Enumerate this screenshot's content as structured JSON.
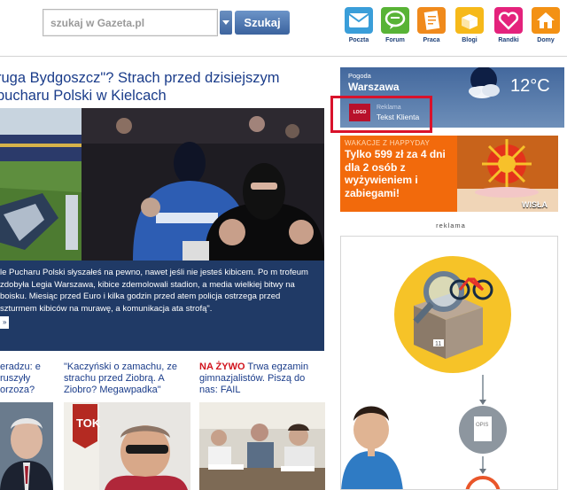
{
  "search": {
    "placeholder": "szukaj w Gazeta.pl",
    "button_label": "Szukaj"
  },
  "services": [
    {
      "label": "Poczta",
      "icon": "mail-icon",
      "color": "#3a9ed9"
    },
    {
      "label": "Forum",
      "icon": "speech-bubble-icon",
      "color": "#58b336"
    },
    {
      "label": "Praca",
      "icon": "document-icon",
      "color": "#f08a1c"
    },
    {
      "label": "Blogi",
      "icon": "box-icon",
      "color": "#f6b91a"
    },
    {
      "label": "Randki",
      "icon": "heart-icon",
      "color": "#e4227c"
    },
    {
      "label": "Domy",
      "icon": "house-icon",
      "color": "#f39114"
    }
  ],
  "main": {
    "headline": "ruga Bydgoszcz\"? Strach przed dzisiejszym pucharu Polski w Kielcach",
    "caption": "le Pucharu Polski słyszałeś na pewno, nawet jeśli nie jesteś kibicem. Po m trofeum zdobyła Legia Warszawa, kibice zdemolowali stadion, a media wielkiej bitwy na boisku. Miesiąc przed Euro i kilka godzin przed atem policja ostrzega przed szturmem kibiców na murawę, a komunikacja ata strofą\".",
    "caption_more": "»",
    "stories": [
      {
        "text": "eradzu: e ruszyły orzoza?"
      },
      {
        "text": "\"Kaczyński o zamachu, ze strachu przed Ziobrą. A Ziobro? Megawpadka\""
      },
      {
        "live": "NA ŻYWO",
        "text": " Trwa egzamin gimnazjalistów. Piszą do nas: FAIL"
      }
    ]
  },
  "weather": {
    "label": "Pogoda",
    "city": "Warszawa",
    "temp": "12°C",
    "ad_logo": "LOGO",
    "ad_kind": "Reklama",
    "ad_client": "Tekst Klienta"
  },
  "promo": {
    "kicker": "WAKACJE Z HAPPYDAY",
    "text": "Tylko 599 zł za 4 dni dla 2 osób z wyżywieniem i zabiegami!",
    "tag": "WISŁA"
  },
  "ad": {
    "label": "reklama",
    "box_text": "11",
    "doc_text": "OPIS"
  },
  "colors": {
    "link": "#1a3c8a",
    "caption_bg": "#203a66",
    "promo_bg": "#f26a0c",
    "highlight": "#d9122b",
    "live": "#d1131d"
  }
}
